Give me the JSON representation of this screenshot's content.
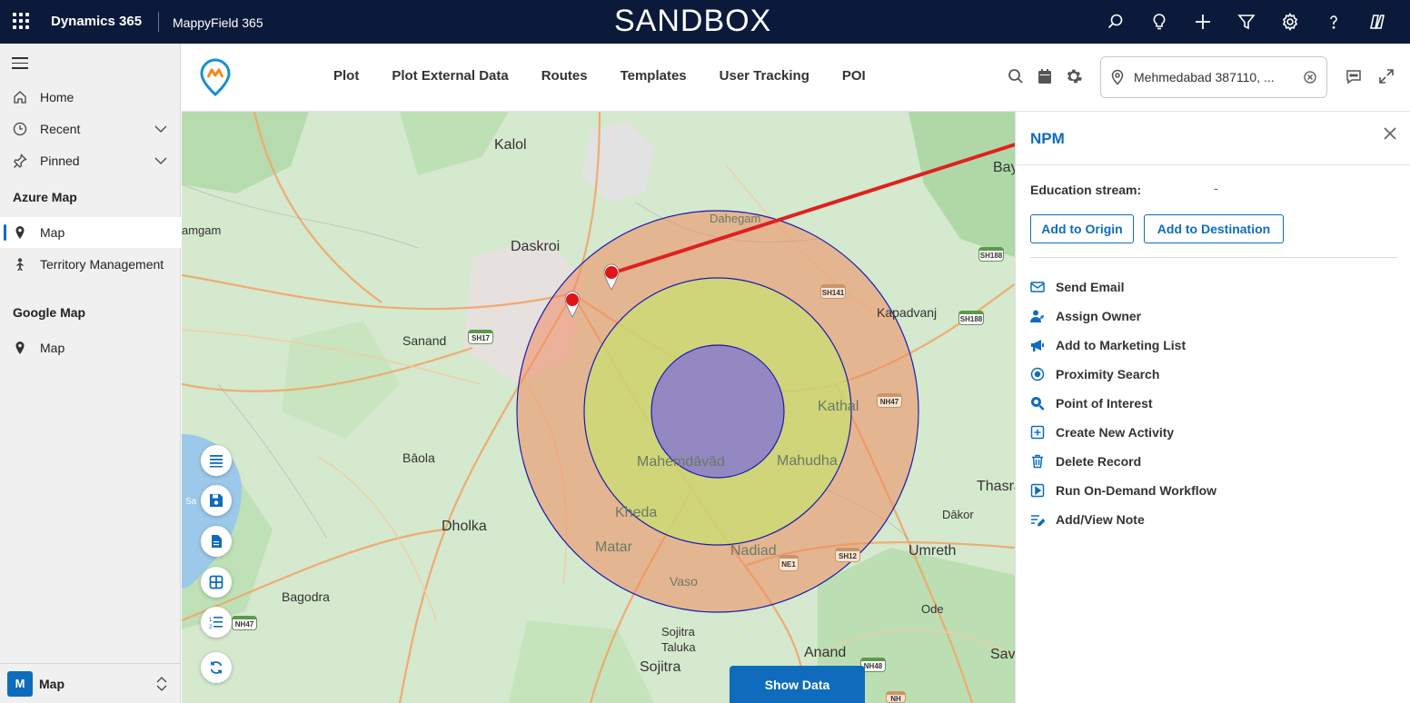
{
  "topbar": {
    "brand": "Dynamics 365",
    "app": "MappyField 365",
    "environment": "SANDBOX",
    "icons": [
      "search-icon",
      "lightbulb-icon",
      "plus-icon",
      "filter-icon",
      "gear-icon",
      "help-icon",
      "copilot-icon"
    ]
  },
  "leftnav": {
    "items": [
      {
        "label": "Home",
        "icon": "home-icon"
      },
      {
        "label": "Recent",
        "icon": "clock-icon"
      },
      {
        "label": "Pinned",
        "icon": "pin-icon"
      }
    ],
    "groups": [
      {
        "title": "Azure Map",
        "items": [
          {
            "label": "Map",
            "icon": "map-pin-icon"
          },
          {
            "label": "Territory Management",
            "icon": "territory-icon"
          }
        ]
      },
      {
        "title": "Google Map",
        "items": [
          {
            "label": "Map",
            "icon": "map-pin-icon"
          }
        ]
      }
    ],
    "area": {
      "badge": "M",
      "label": "Map"
    }
  },
  "header": {
    "menu": [
      "Plot",
      "Plot External Data",
      "Routes",
      "Templates",
      "User Tracking",
      "POI"
    ],
    "location_value": "Mehmedabad 387110, ..."
  },
  "map": {
    "labels": {
      "kalol": "Kalol",
      "daskroi": "Daskroi",
      "sanand": "Sanand",
      "baola": "Bāola",
      "dholka": "Dholka",
      "bagodra": "Bagodra",
      "dahegam": "Dahegam",
      "kapadvanj": "Kapadvanj",
      "kathal": "Kathal",
      "mahemdavad": "Mahemdāvād",
      "mahudha": "Mahudha",
      "kheda": "Kheda",
      "matar": "Matar",
      "nadiad": "Nadiad",
      "vaso": "Vaso",
      "sojitra_taluka_1": "Sojitra",
      "sojitra_taluka_2": "Taluka",
      "sojitra": "Sojitra",
      "anand": "Anand",
      "umreth": "Umreth",
      "dakor": "Dākor",
      "ode": "Ode",
      "bayad": "Baya",
      "thasra": "Thasra",
      "sav": "Sav",
      "amgam": "amgam",
      "lake": "Sa"
    },
    "shields": {
      "sh188a": "SH188",
      "sh188b": "SH188",
      "sh141": "SH141",
      "sh17": "SH17",
      "nh47a": "NH47",
      "nh47b": "NH47",
      "sh12": "SH12",
      "nh48": "NH48",
      "ne1": "NE1",
      "nh": "NH"
    },
    "show_data": "Show Data",
    "tools": [
      "list-icon",
      "save-icon",
      "document-icon",
      "table-icon",
      "numbered-list-icon",
      "refresh-icon"
    ]
  },
  "panel": {
    "title": "NPM",
    "field_label": "Education stream:",
    "field_value": "-",
    "add_origin": "Add to Origin",
    "add_destination": "Add to Destination",
    "actions": [
      {
        "label": "Send Email",
        "icon": "email-icon"
      },
      {
        "label": "Assign Owner",
        "icon": "assign-owner-icon"
      },
      {
        "label": "Add to Marketing List",
        "icon": "megaphone-icon"
      },
      {
        "label": "Proximity Search",
        "icon": "proximity-icon"
      },
      {
        "label": "Point of Interest",
        "icon": "poi-search-icon"
      },
      {
        "label": "Create New Activity",
        "icon": "new-activity-icon"
      },
      {
        "label": "Delete Record",
        "icon": "trash-icon"
      },
      {
        "label": "Run On-Demand Workflow",
        "icon": "workflow-icon"
      },
      {
        "label": "Add/View Note",
        "icon": "note-icon"
      }
    ]
  },
  "colors": {
    "topbar": "#0b1a3a",
    "accent": "#0f6cbd",
    "ring_outer": "#f0a080",
    "ring_middle": "#c8e070",
    "ring_inner": "#8a7ad0",
    "pointer_line": "#e02020"
  }
}
